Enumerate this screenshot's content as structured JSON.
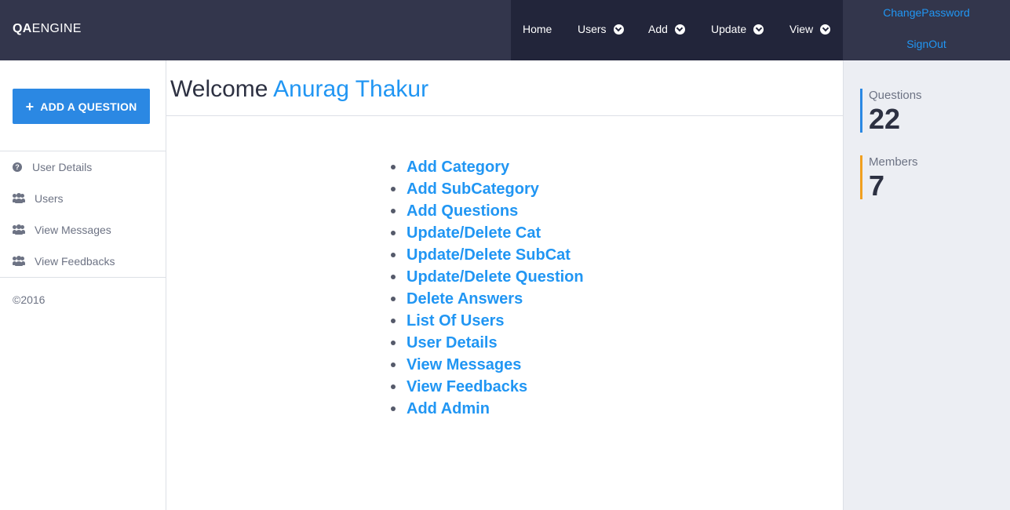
{
  "brand": {
    "bold": "QA",
    "light": "ENGINE"
  },
  "nav": {
    "items": [
      {
        "label": "Home",
        "dropdown": false
      },
      {
        "label": "Users",
        "dropdown": true
      },
      {
        "label": "Add",
        "dropdown": true
      },
      {
        "label": "Update",
        "dropdown": true
      },
      {
        "label": "View",
        "dropdown": true
      }
    ]
  },
  "account": {
    "change_password": "ChangePassword",
    "sign_out": "SignOut"
  },
  "sidebar": {
    "add_button": "ADD A QUESTION",
    "items": [
      {
        "label": "User Details",
        "icon": "question-circle-icon"
      },
      {
        "label": "Users",
        "icon": "users-icon"
      },
      {
        "label": "View Messages",
        "icon": "users-icon"
      },
      {
        "label": "View Feedbacks",
        "icon": "users-icon"
      }
    ],
    "copyright": "©2016"
  },
  "main": {
    "welcome_prefix": "Welcome",
    "user_name": "Anurag Thakur",
    "links": [
      "Add Category",
      "Add SubCategory",
      "Add Questions",
      "Update/Delete Cat",
      "Update/Delete SubCat",
      "Update/Delete Question",
      "Delete Answers",
      "List Of Users",
      "User Details",
      "View Messages",
      "View Feedbacks",
      "Add Admin"
    ]
  },
  "stats": [
    {
      "label": "Questions",
      "value": "22",
      "color": "#2b88e3"
    },
    {
      "label": "Members",
      "value": "7",
      "color": "#f0a020"
    }
  ],
  "colors": {
    "topbar": "#33364c",
    "nav": "#22253a",
    "accent": "#2196f3",
    "button": "#2b88e3"
  }
}
